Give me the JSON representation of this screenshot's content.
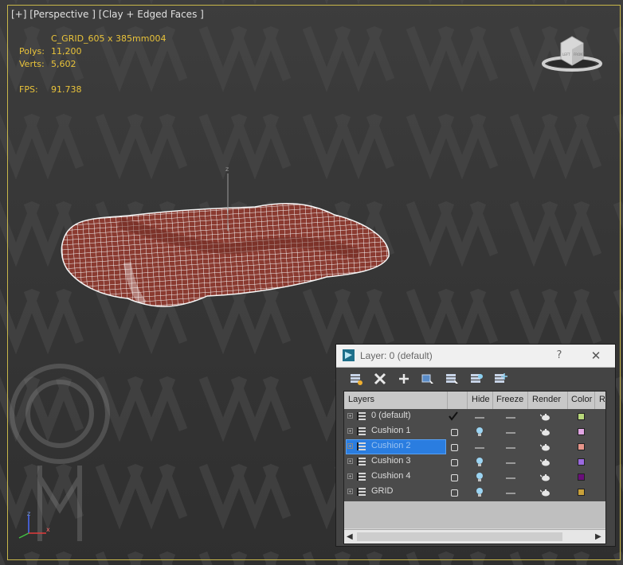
{
  "viewport": {
    "label_plus": "[+]",
    "label_view": "[Perspective ]",
    "label_shading": "[Clay + Edged Faces ]",
    "object_name": "C_GRID_605 x 385mm004",
    "stats": {
      "polys_label": "Polys:",
      "polys_value": "11,200",
      "verts_label": "Verts:",
      "verts_value": "5,602",
      "fps_label": "FPS:",
      "fps_value": "91.738"
    },
    "gizmo_z_label": "z",
    "viewcube_front": "FRONT",
    "viewcube_left": "LEFT",
    "axis_z": "z",
    "axis_x": "x",
    "colors": {
      "border": "#c8b74a",
      "stats_text": "#e9c33a",
      "mesh_fill": "#8a3a30",
      "mesh_wire": "#f4f4f4"
    }
  },
  "layer_dialog": {
    "title": "Layer: 0 (default)",
    "help_label": "?",
    "close_label": "✕",
    "toolbar": [
      "create-layer-icon",
      "delete-layer-icon",
      "add-selection-icon",
      "select-highlighted-icon",
      "highlight-selected-icon",
      "hide-all-icon",
      "freeze-all-icon"
    ],
    "columns": {
      "layers": "Layers",
      "hide": "Hide",
      "freeze": "Freeze",
      "render": "Render",
      "color": "Color",
      "radiosity": "R"
    },
    "rows": [
      {
        "name": "0 (default)",
        "active": true,
        "selected": false,
        "hidden": false,
        "color": "#b8d87a"
      },
      {
        "name": "Cushion 1",
        "active": false,
        "selected": false,
        "hidden": true,
        "color": "#e2a6e4"
      },
      {
        "name": "Cushion 2",
        "active": false,
        "selected": true,
        "hidden": false,
        "color": "#e7958a"
      },
      {
        "name": "Cushion 3",
        "active": false,
        "selected": false,
        "hidden": true,
        "color": "#9b6ae0"
      },
      {
        "name": "Cushion 4",
        "active": false,
        "selected": false,
        "hidden": true,
        "color": "#6a0f7a"
      },
      {
        "name": "GRID",
        "active": false,
        "selected": false,
        "hidden": true,
        "color": "#c9a13a"
      }
    ]
  }
}
